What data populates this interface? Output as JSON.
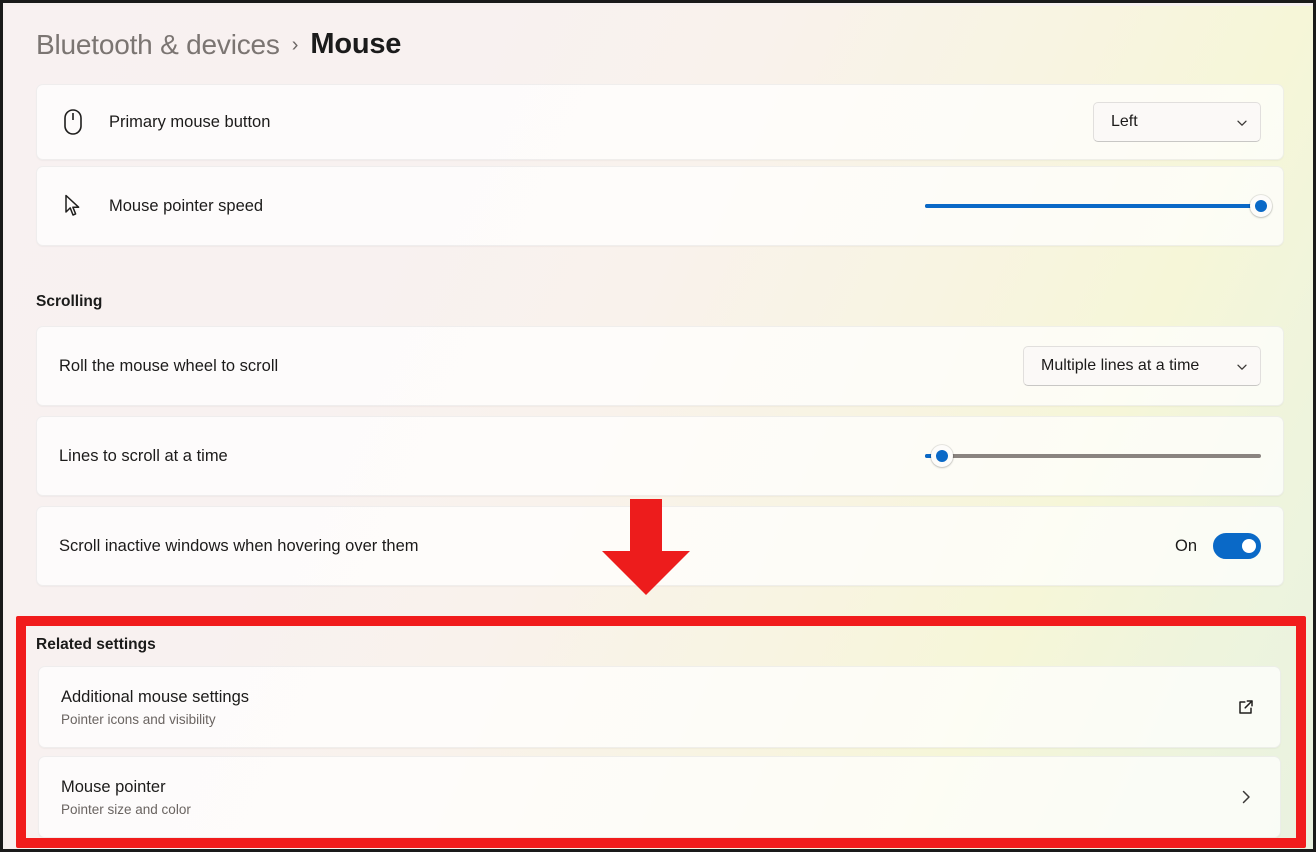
{
  "header": {
    "breadcrumb_parent": "Bluetooth & devices",
    "breadcrumb_separator": "›",
    "breadcrumb_current": "Mouse"
  },
  "settings": {
    "primary_mouse_button": {
      "label": "Primary mouse button",
      "icon": "mouse-icon",
      "value": "Left"
    },
    "mouse_pointer_speed": {
      "label": "Mouse pointer speed",
      "icon": "cursor-arrow-icon",
      "fill_percent": 100,
      "thumb_percent": 100
    }
  },
  "scrolling": {
    "heading": "Scrolling",
    "roll_wheel": {
      "label": "Roll the mouse wheel to scroll",
      "value": "Multiple lines at a time"
    },
    "lines_to_scroll": {
      "label": "Lines to scroll at a time",
      "fill_percent": 5,
      "thumb_percent": 5
    },
    "scroll_inactive": {
      "label": "Scroll inactive windows when hovering over them",
      "state_label": "On",
      "state_on": true
    }
  },
  "related_settings": {
    "heading": "Related settings",
    "items": [
      {
        "title": "Additional mouse settings",
        "subtitle": "Pointer icons and visibility",
        "action_icon": "external-link-icon"
      },
      {
        "title": "Mouse pointer",
        "subtitle": "Pointer size and color",
        "action_icon": "chevron-right-icon"
      }
    ]
  },
  "annotations": {
    "highlight_box_color": "#F11C1C",
    "arrow_color": "#ED1C1C",
    "arrow_direction": "down"
  },
  "colors": {
    "accent": "#0A69C7",
    "page_background": "#F8F1F1",
    "card_background": "#FFFFFF",
    "text_primary": "#1C1B1A",
    "text_secondary": "#6A6461"
  }
}
